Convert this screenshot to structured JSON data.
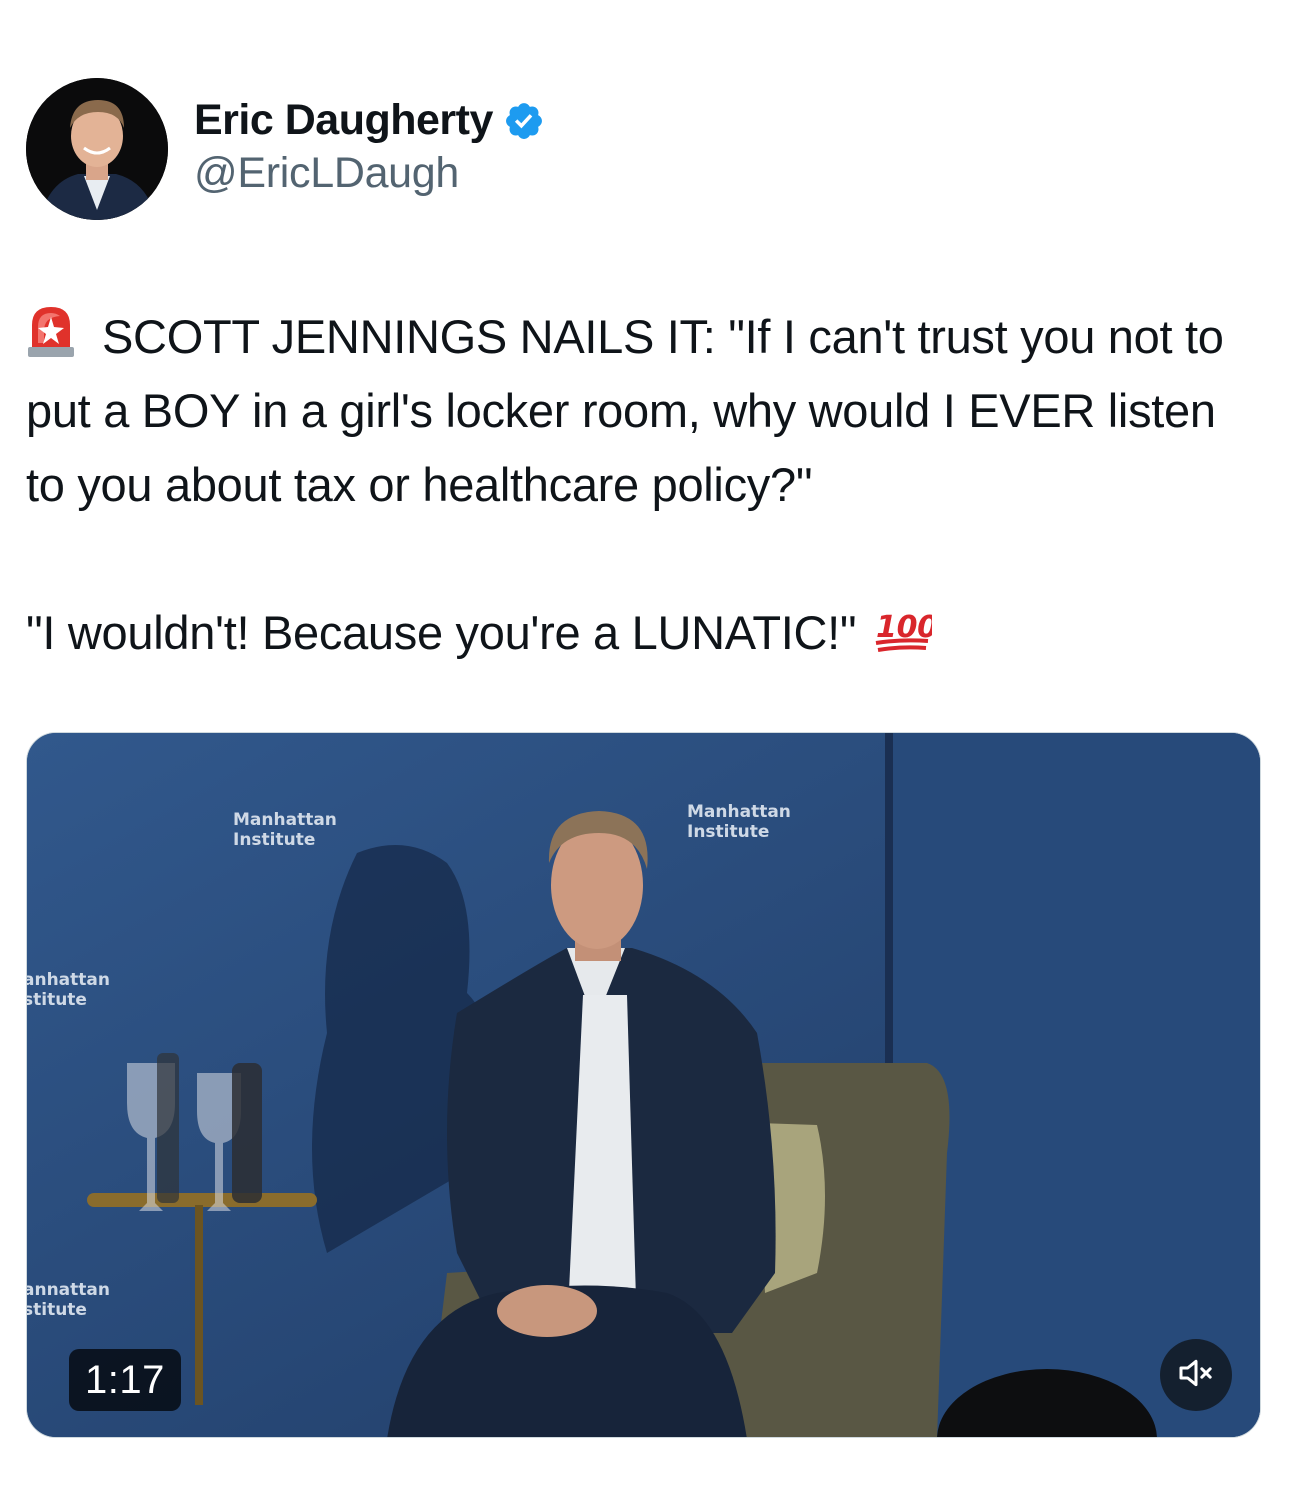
{
  "author": {
    "display_name": "Eric Daugherty",
    "handle": "@EricLDaugh",
    "verified": true,
    "avatar_icon": "profile-photo"
  },
  "tweet": {
    "paragraph_1": "SCOTT JENNINGS NAILS IT: \"If I can't trust you not to put a BOY in a girl's locker room, why would I EVER listen to you about tax or healthcare policy?\"",
    "paragraph_2": "\"I wouldn't! Because you're a LUNATIC!\"",
    "leading_emoji": "rotating-light-emoji",
    "trailing_emoji": "hundred-points-emoji"
  },
  "media": {
    "type": "video",
    "duration": "1:17",
    "muted": true,
    "mute_icon": "speaker-muted-icon",
    "backdrop_texts": [
      "Manhattan\nInstitute",
      "Manhattan\nInstitute",
      "anhattan\nstitute",
      "annattan\nstitute"
    ]
  },
  "colors": {
    "text": "#0f1419",
    "secondary_text": "#536471",
    "verified_badge": "#1d9bf0",
    "backdrop_blue": "#2b4a78"
  }
}
